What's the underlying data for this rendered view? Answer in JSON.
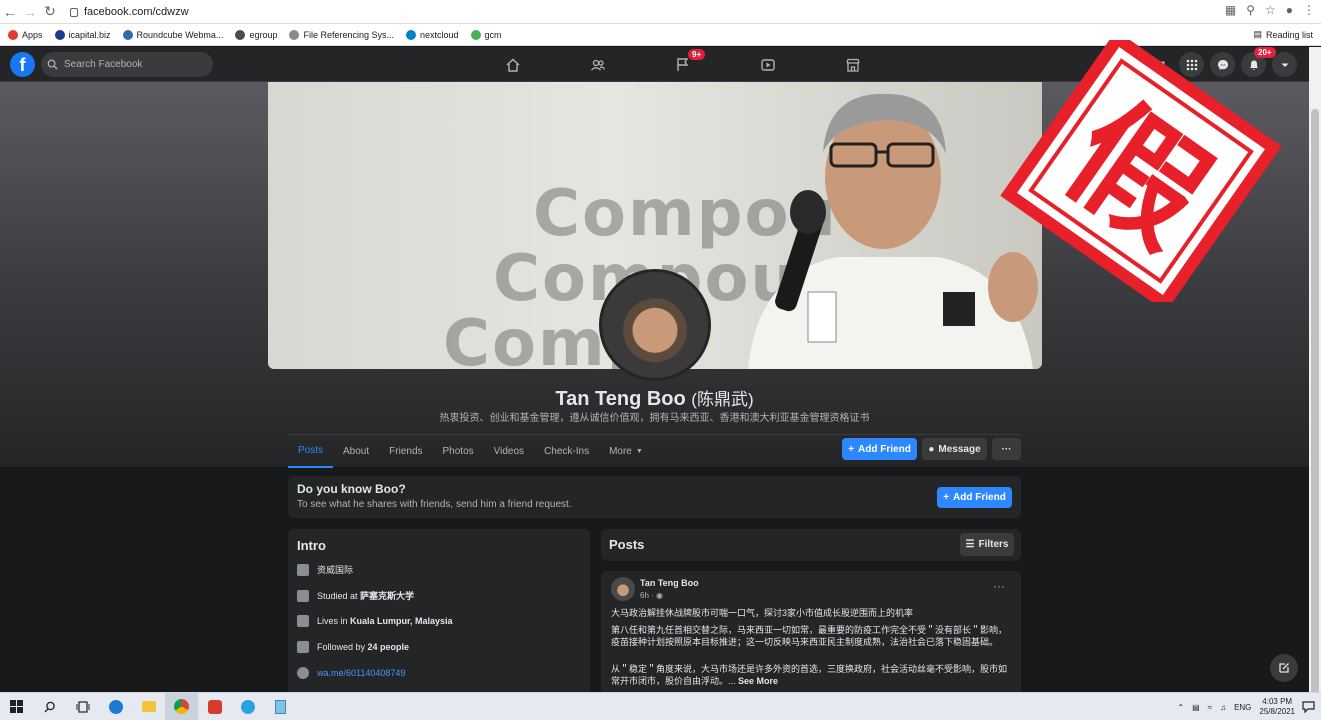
{
  "browser": {
    "url": "facebook.com/cdwzw",
    "reading_list": "Reading list",
    "bookmarks": [
      {
        "label": "Apps",
        "color": "#e33b2e"
      },
      {
        "label": "icapital.biz",
        "color": "#1a3a8a"
      },
      {
        "label": "Roundcube Webma...",
        "color": "#2d6db5"
      },
      {
        "label": "egroup",
        "color": "#4a4a4a"
      },
      {
        "label": "File Referencing Sys...",
        "color": "#8a8a8a"
      },
      {
        "label": "nextcloud",
        "color": "#0082c9"
      },
      {
        "label": "gcm",
        "color": "#4caf50"
      }
    ]
  },
  "fb_header": {
    "search_placeholder": "Search Facebook",
    "user_name": "Ling",
    "groups_badge": "9+",
    "notif_badge": "20+"
  },
  "cover": {
    "words": [
      "Compou",
      "Compou",
      "Compo"
    ]
  },
  "profile": {
    "name": "Tan Teng Boo",
    "name_cn": "(陈鼎武)",
    "bio": "热衷投资、创业和基金管理，遵从诚信价值观，拥有马来西亚、香港和澳大利亚基金管理资格证书",
    "tabs": [
      "Posts",
      "About",
      "Friends",
      "Photos",
      "Videos",
      "Check-Ins",
      "More"
    ],
    "add_friend": "Add Friend",
    "message": "Message",
    "more_dots": "···"
  },
  "know": {
    "title": "Do you know Boo?",
    "subtitle": "To see what he shares with friends, send him a friend request.",
    "button": "Add Friend"
  },
  "intro": {
    "title": "Intro",
    "rows": [
      {
        "text": "资威国际",
        "bold": ""
      },
      {
        "text": "Studied at ",
        "bold": "萨塞克斯大学"
      },
      {
        "text": "Lives in ",
        "bold": "Kuala Lumpur, Malaysia"
      },
      {
        "text": "Followed by ",
        "bold": "24 people"
      },
      {
        "text": "wa.me/601140408749",
        "bold": ""
      }
    ]
  },
  "posts": {
    "title": "Posts",
    "filters": "Filters",
    "post": {
      "author": "Tan Teng Boo",
      "time": "6h · ",
      "p1": "大马政治解挂休战牌股市可喘一口气，探讨3家小市值成长股逆围而上的机率",
      "p2": "第八任和第九任首相交替之际，马来西亚一切如常，最重要的防疫工作完全不受＂没有部长＂影响，疫苗接种计划按照原本目标推进；这一切反映马来西亚民主制度成熟，法治社会已落下稳固基础。",
      "p3": "从＂稳定＂角度来说，大马市场还是许多外资的首选，三度换政府，社会活动丝毫不受影响，股市如常开市闭市，股价自由浮动。...",
      "see_more": " See More"
    }
  },
  "stamp": {
    "char": "假",
    "color": "#e8202a"
  },
  "taskbar": {
    "lang": "ENG",
    "time": "4:03 PM",
    "date": "25/8/2021"
  }
}
